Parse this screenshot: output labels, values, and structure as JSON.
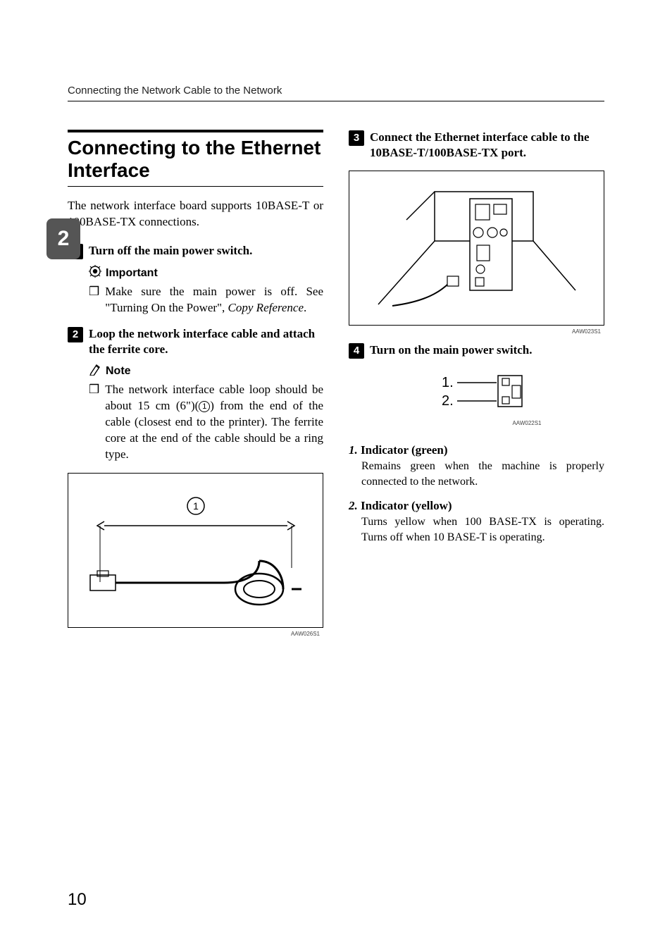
{
  "running_head": "Connecting the Network Cable to the Network",
  "spine_tab": "2",
  "page_number": "10",
  "section": {
    "title": "Connecting to the Ethernet Interface"
  },
  "intro": "The network interface board supports 10BASE-T or 100BASE-TX connections.",
  "steps": {
    "s1": {
      "num": "1",
      "text": "Turn off the main power switch.",
      "important_label": "Important",
      "important_body": "Make sure the main power is off. See \"Turning On the Power\", ",
      "important_ref": "Copy Reference"
    },
    "s2": {
      "num": "2",
      "text": "Loop the network interface cable and attach the ferrite core.",
      "note_label": "Note",
      "note_body_a": "The network interface cable loop should be about 15 cm (6\")(",
      "note_body_b": ") from the end of the cable (closest end to the printer). The ferrite core at the end of the cable should be a ring type.",
      "circled": "1"
    },
    "s3": {
      "num": "3",
      "text": "Connect the Ethernet interface cable to the 10BASE-T/100BASE-TX port."
    },
    "s4": {
      "num": "4",
      "text": "Turn on the main power switch."
    }
  },
  "figures": {
    "cable_code": "AAW026S1",
    "port_code": "AAW023S1",
    "indicator_code": "AAW022S1",
    "indicator_labels": {
      "one": "1.",
      "two": "2."
    }
  },
  "indicators": {
    "i1": {
      "num": "1.",
      "label": "Indicator (green)",
      "body": "Remains green when the machine is properly connected to the network."
    },
    "i2": {
      "num": "2.",
      "label": "Indicator (yellow)",
      "body": "Turns yellow when 100 BASE-TX is operating. Turns off when 10 BASE-T is operating."
    }
  }
}
